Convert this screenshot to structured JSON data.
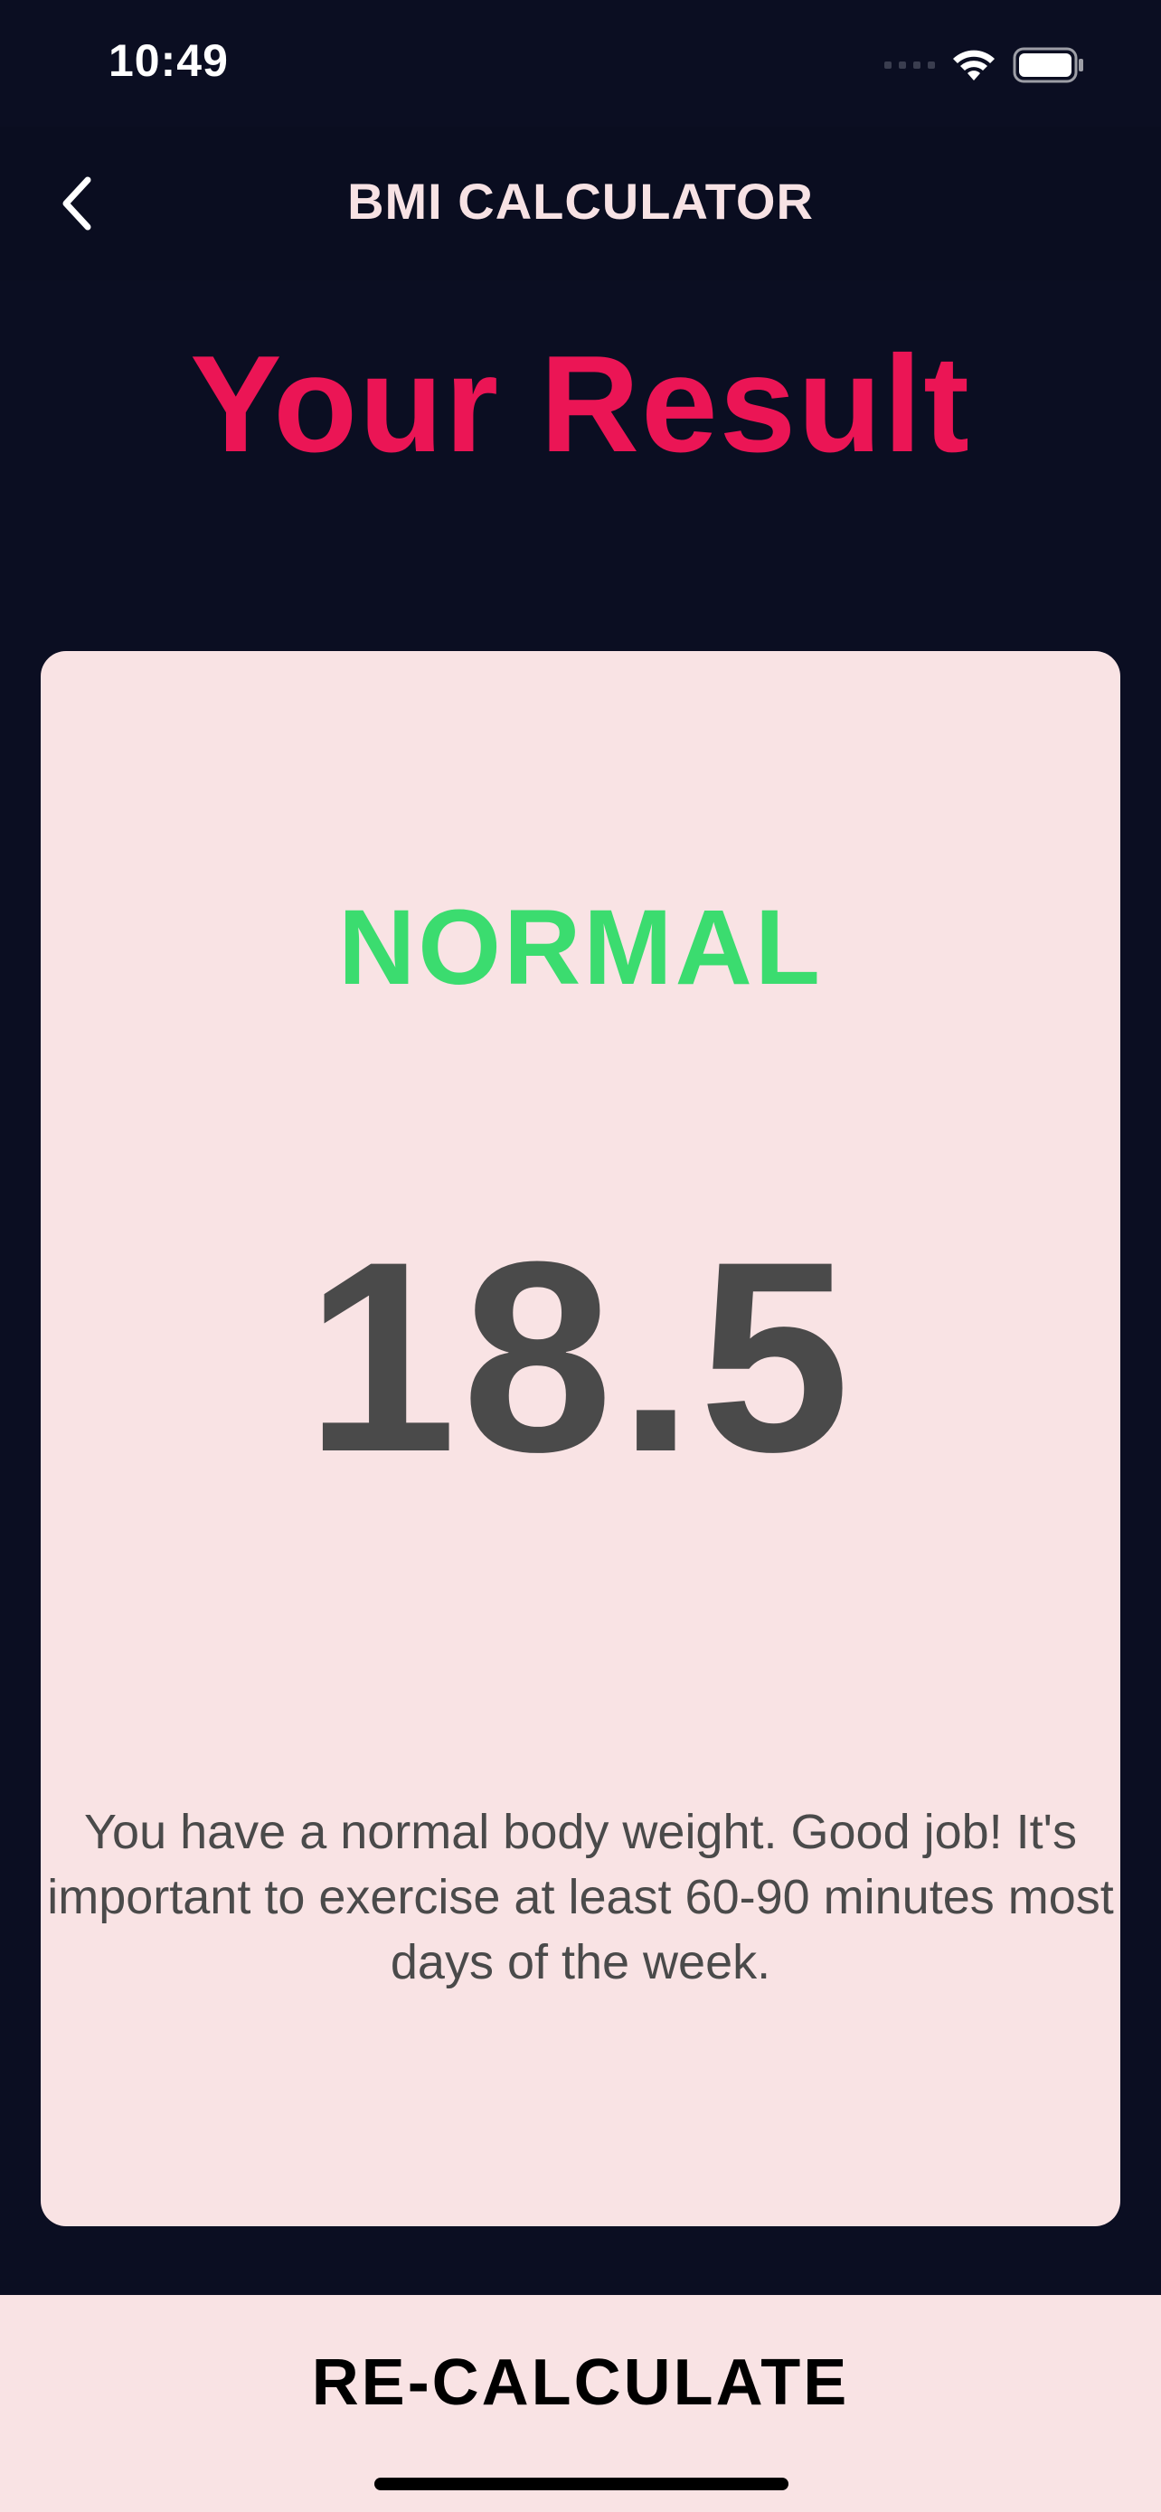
{
  "status_bar": {
    "time": "10:49"
  },
  "nav": {
    "title": "BMI CALCULATOR",
    "back_icon": "chevron-left-icon"
  },
  "page": {
    "title": "Your Result"
  },
  "result": {
    "status": "NORMAL",
    "bmi_value": "18.5",
    "message": "You have a normal body weight. Good job! It's important to exercise at least 60-90 minutes most days of the week."
  },
  "footer": {
    "button_label": "RE-CALCULATE"
  },
  "colors": {
    "background": "#0b0e22",
    "accent": "#eb1555",
    "card": "#f9e3e4",
    "status_normal": "#3bdc6f",
    "value_text": "#4a4a4a"
  }
}
